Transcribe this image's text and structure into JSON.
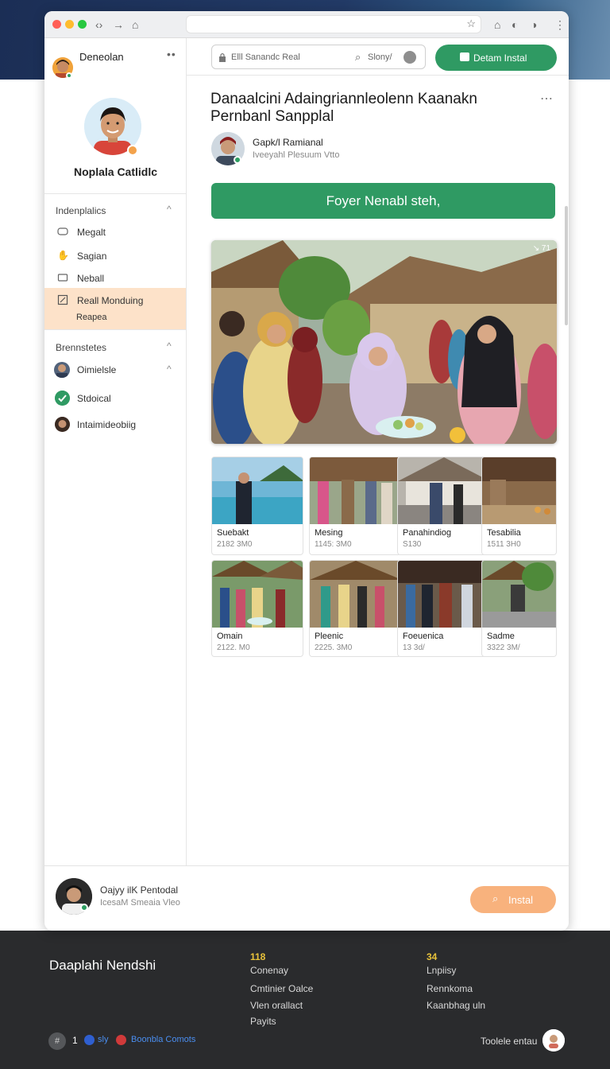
{
  "sidebar": {
    "user_name": "Deneolan",
    "more_icon": "••",
    "profile_name": "Noplala Catlidlc",
    "section1": {
      "title": "Indenplalics",
      "items": [
        {
          "label": "Megalt",
          "icon": "gamepad-icon"
        },
        {
          "label": "Sagian",
          "icon": "hand-icon"
        },
        {
          "label": "Neball",
          "icon": "card-icon"
        },
        {
          "label": "Reall Monduing",
          "label2": "Reapea",
          "icon": "edit-icon",
          "active": true
        }
      ]
    },
    "section2": {
      "title": "Brennstetes",
      "items": [
        {
          "label": "Oimielsle",
          "icon": "avatar"
        },
        {
          "label": "Stdoical",
          "icon": "check-icon"
        },
        {
          "label": "Intaimideobiig",
          "icon": "avatar"
        }
      ]
    }
  },
  "topbar": {
    "search_placeholder": "Elll Sanandc Real",
    "search_label": "Slony/",
    "install_label": "Detam Instal"
  },
  "post": {
    "title": "Danaalcini Adaingriannleolenn Kaanakn Pernbanl Sanpplal",
    "author_name": "Gapk/l Ramianal",
    "author_sub": "Iveeyahl Plesuum Vtto",
    "cta_label": "Foyer Nenabl  steh,",
    "hero_badge": "↘ 71"
  },
  "thumbnails": [
    {
      "title": "Suebakt",
      "sub": "2182 3M0"
    },
    {
      "title": "Mesing",
      "sub": "1145: 3M0"
    },
    {
      "title": "Panahindiog",
      "sub": "S130"
    },
    {
      "title": "Tesabilia",
      "sub": "1511 3H0"
    },
    {
      "title": "Omain",
      "sub": "2122. M0"
    },
    {
      "title": "Pleenic",
      "sub": "2225. 3M0"
    },
    {
      "title": "Foeuenica",
      "sub": "13 3d/"
    },
    {
      "title": "Sadme",
      "sub": "3322 3M/"
    }
  ],
  "bottom_bar": {
    "name": "Oajyy ilK Pentodal",
    "sub": "IcesaM Smeaia Vleo",
    "install_label": "Instal"
  },
  "footer": {
    "title": "Daaplahi Nendshi",
    "col1_num": "118",
    "col1_links": [
      "Conenay",
      "Cmtinier Oalce",
      "Vlen orallact",
      "Payits"
    ],
    "col2_num": "34",
    "col2_links": [
      "Lnpiisy",
      "Rennkoma",
      "Kaanbhag uln"
    ],
    "count": "1",
    "tag1": "sly",
    "tag2": "Boonbla Comots",
    "right_label": "Toolele entau"
  },
  "colors": {
    "accent_green": "#2f9a63",
    "accent_peach": "#f8b27d",
    "active_item": "#fde2c9"
  }
}
